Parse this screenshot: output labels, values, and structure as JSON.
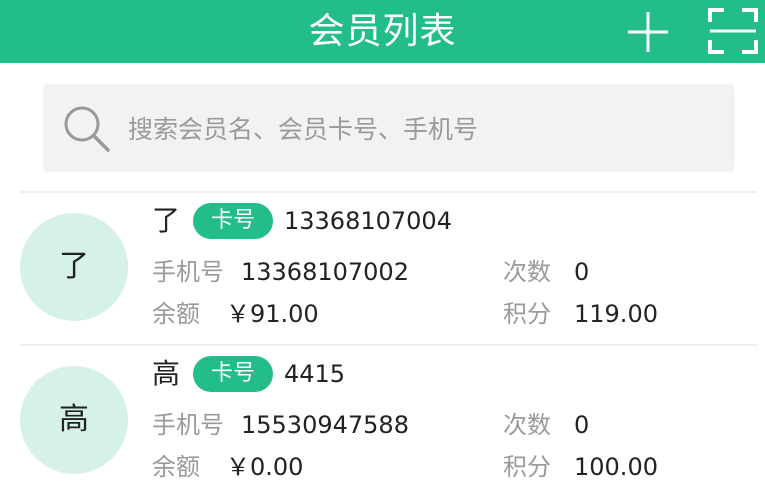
{
  "header": {
    "title": "会员列表",
    "add_icon": "plus-icon",
    "scan_icon": "scan-icon",
    "bg_color": "#22bd88"
  },
  "search": {
    "placeholder": "搜索会员名、会员卡号、手机号",
    "value": ""
  },
  "labels": {
    "card_badge": "卡号",
    "phone": "手机号",
    "count": "次数",
    "balance": "余额",
    "points": "积分"
  },
  "members": [
    {
      "avatar": "了",
      "name": "了",
      "card_no": "13368107004",
      "phone": "13368107002",
      "count": "0",
      "balance": "￥91.00",
      "points": "119.00"
    },
    {
      "avatar": "高",
      "name": "高",
      "card_no": "4415",
      "phone": "15530947588",
      "count": "0",
      "balance": "￥0.00",
      "points": "100.00"
    }
  ]
}
